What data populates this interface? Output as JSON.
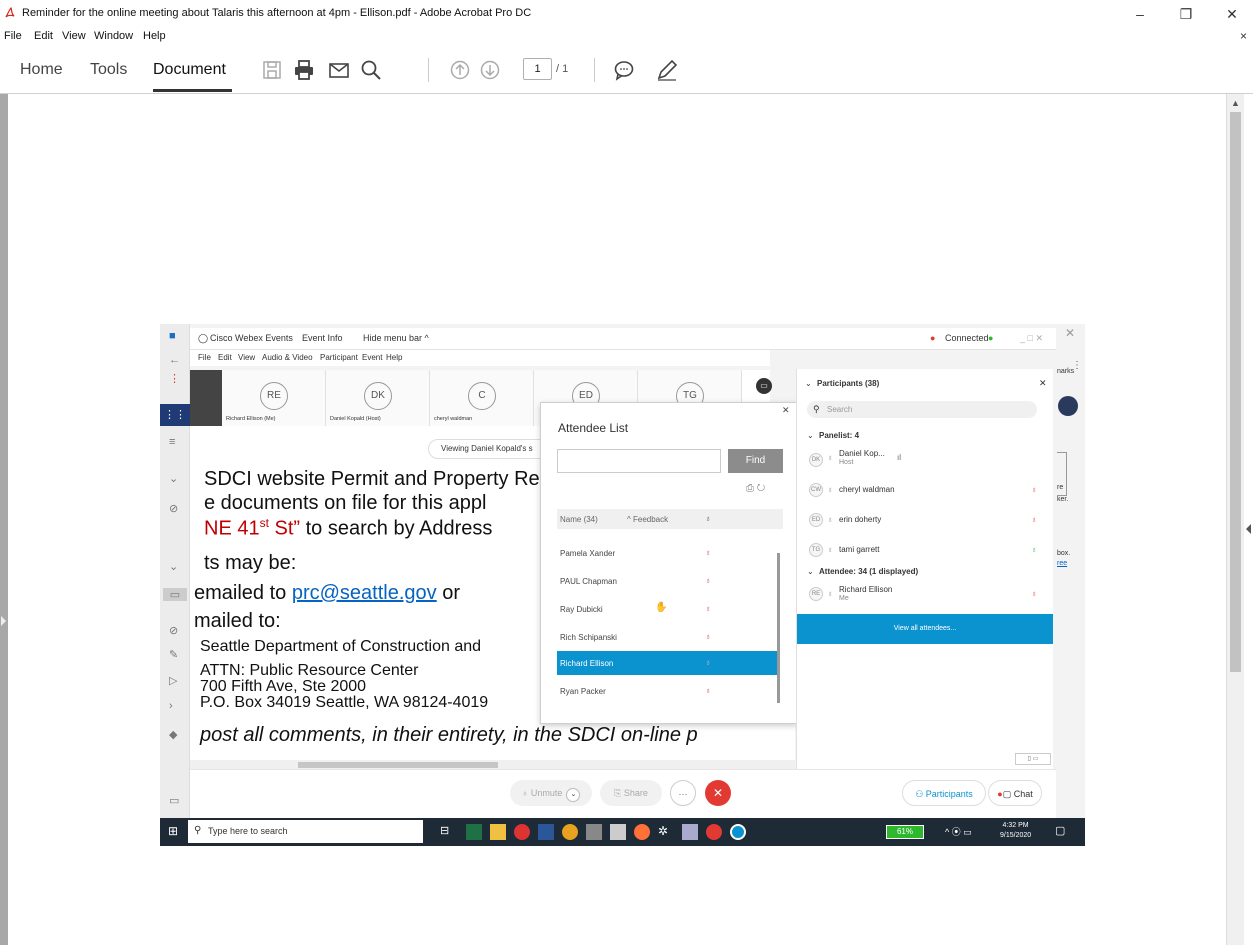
{
  "window": {
    "title": "Reminder for the online meeting about Talaris this afternoon at 4pm - Ellison.pdf - Adobe Acrobat Pro DC",
    "minimize": "–",
    "restore": "❐",
    "close": "✕"
  },
  "menu": [
    "File",
    "Edit",
    "View",
    "Window",
    "Help"
  ],
  "menu_close": "×",
  "toolbar": {
    "tabs": [
      "Home",
      "Tools",
      "Document"
    ],
    "page_current": "1",
    "page_total": "/ 1"
  },
  "shot": {
    "webex": {
      "app_name": "Cisco Webex Events",
      "event_info": "Event Info",
      "hide_menu": "Hide menu bar ^",
      "connected": "Connected",
      "menu": [
        "File",
        "Edit",
        "View",
        "Audio & Video",
        "Participant",
        "Event",
        "Help"
      ]
    },
    "video_tiles": [
      {
        "initials": "RE",
        "name": "Richard Ellison (Me)"
      },
      {
        "initials": "DK",
        "name": "Daniel Kopald (Host)"
      },
      {
        "initials": "C",
        "name": "cheryl waldman"
      },
      {
        "initials": "ED",
        "name": ""
      },
      {
        "initials": "TG",
        "name": ""
      }
    ],
    "viewing": "Viewing Daniel Kopald's s",
    "slide": {
      "line1": "SDCI website Permit and Property Records (",
      "line2": "e documents on file for this appl",
      "line3a": "NE 41",
      "line3sup": "st",
      "line3b": " St”",
      "line3c": " to search by Address",
      "line4": "ts may be:",
      "line5a": "emailed to ",
      "line5link": "prc@seattle.gov",
      "line5b": " or",
      "line6": "mailed to:",
      "line7": "Seattle Department of Construction and",
      "line8": "ATTN: Public Resource Center",
      "line9": "700 Fifth Ave, Ste 2000",
      "line10": "P.O. Box 34019 Seattle, WA 98124-4019",
      "line11": "post all comments, in their entirety, in the SDCI on-line p"
    },
    "attendee_list": {
      "title": "Attendee List",
      "find": "Find",
      "col_name": "Name (34)",
      "col_feedback": "^ Feedback",
      "rows": [
        "Pamela Xander",
        "PAUL Chapman",
        "Ray Dubicki",
        "Rich Schipanski",
        "Richard Ellison",
        "Ryan Packer"
      ],
      "selected": "Richard Ellison"
    },
    "participants": {
      "header": "Participants (38)",
      "search": "Search",
      "panelist_header": "Panelist: 4",
      "panelists": [
        {
          "initials": "DK",
          "name": "Daniel Kop...",
          "role": "Host"
        },
        {
          "initials": "CW",
          "name": "cheryl waldman",
          "role": ""
        },
        {
          "initials": "ED",
          "name": "erin doherty",
          "role": ""
        },
        {
          "initials": "TG",
          "name": "tami garrett",
          "role": ""
        }
      ],
      "attendee_header": "Attendee: 34 (1 displayed)",
      "attendee": {
        "initials": "RE",
        "name": "Richard Ellison",
        "role": "Me"
      },
      "view_all": "View all attendees..."
    },
    "controls": {
      "unmute": "Unmute",
      "share": "Share",
      "more": "···",
      "leave": "✕",
      "participants": "Participants",
      "chat": "Chat"
    },
    "side_labels": [
      "narks",
      "re",
      "ker.",
      "box.",
      "ree"
    ],
    "taskbar": {
      "search_placeholder": "Type here to search",
      "battery": "61%",
      "time": "4:32 PM",
      "date": "9/15/2020"
    }
  },
  "colors": {
    "webex_blue": "#0b93d0",
    "leave_red": "#e23a33",
    "link_blue": "#0563c1",
    "slide_red": "#c00000"
  }
}
